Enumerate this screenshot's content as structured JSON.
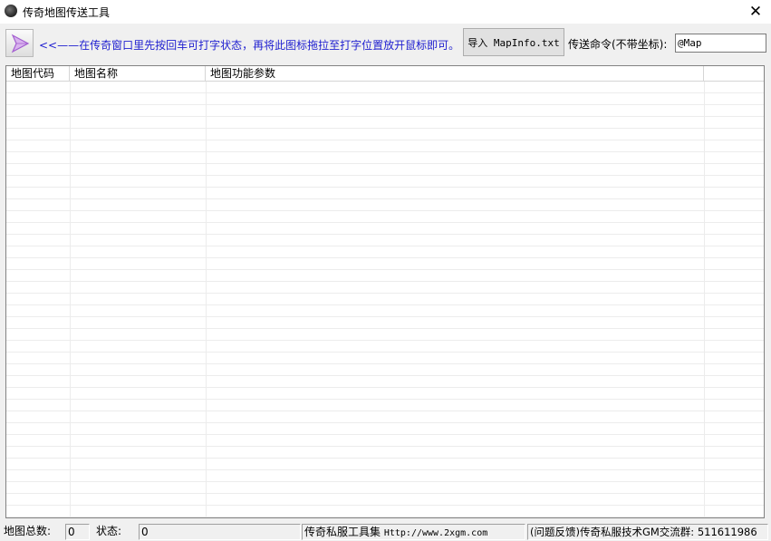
{
  "window": {
    "title": "传奇地图传送工具",
    "close_glyph": "✕"
  },
  "toolbar": {
    "hint": "<<——在传奇窗口里先按回车可打字状态，再将此图标拖拉至打字位置放开鼠标即可。",
    "import_label": "导入 MapInfo.txt",
    "command_label": "传送命令(不带坐标):",
    "command_value": "@Map"
  },
  "table": {
    "columns": [
      "地图代码",
      "地图名称",
      "地图功能参数",
      ""
    ],
    "rows": []
  },
  "status": {
    "map_count_label": "地图总数:",
    "map_count_value": "0",
    "state_label": "状态:",
    "state_value": "0",
    "toolset_label": "传奇私服工具集",
    "toolset_url": "Http://www.2xgm.com",
    "feedback": "(问题反馈)传奇私服技术GM交流群: 511611986"
  },
  "icons": {
    "app": "app-logo-icon",
    "drag": "drag-arrow-icon",
    "close": "close-icon"
  },
  "colors": {
    "hint_text": "#2020d0",
    "drag_arrow": "#b06ad0"
  }
}
